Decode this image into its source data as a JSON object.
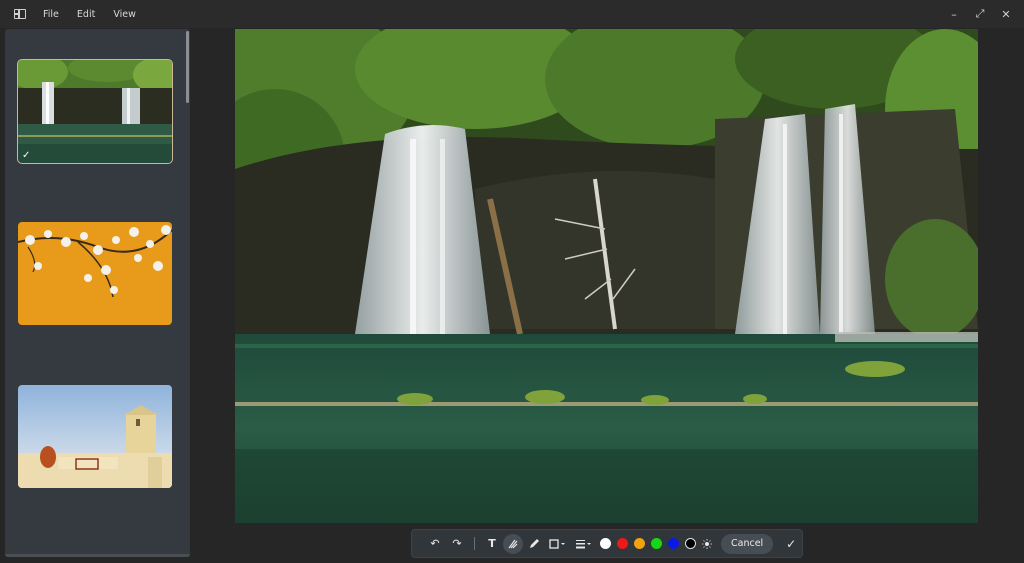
{
  "menu": {
    "file": "File",
    "edit": "Edit",
    "view": "View"
  },
  "window_controls": {
    "minimize": "–",
    "maximize": "⤢",
    "close": "✕"
  },
  "sidebar": {
    "thumbnails": [
      {
        "subject": "waterfall",
        "selected": true
      },
      {
        "subject": "white blossoms on orange"
      },
      {
        "subject": "whitewashed building"
      }
    ],
    "check_mark": "✓"
  },
  "main_image": {
    "subject": "waterfall over mossy cliff into green lake"
  },
  "toolbar": {
    "undo_icon": "↶",
    "redo_icon": "↷",
    "text_tool": "T",
    "colors": [
      "#ffffff",
      "#e81a1a",
      "#f2a20c",
      "#17d617",
      "#0a1ae6",
      "#000000"
    ],
    "cancel_label": "Cancel",
    "confirm_icon": "✓"
  }
}
